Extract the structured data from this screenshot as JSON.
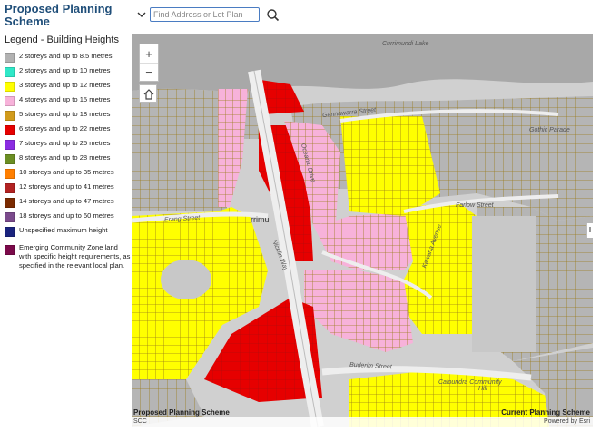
{
  "header": {
    "title": "Proposed Planning Scheme"
  },
  "search": {
    "placeholder": "Find Address or Lot Plan"
  },
  "legend": {
    "title": "Legend - Building Heights",
    "items": [
      {
        "label": "2 storeys and up to 8.5 metres",
        "color": "#b2b2b2"
      },
      {
        "label": "2 storeys and up to 10 metres",
        "color": "#2fe8c8"
      },
      {
        "label": "3 storeys and up to 12 metres",
        "color": "#ffff00"
      },
      {
        "label": "4 storeys and up to 15 metres",
        "color": "#f7b2da"
      },
      {
        "label": "5 storeys and up to 18 metres",
        "color": "#d19b1c"
      },
      {
        "label": "6 storeys and up to 22 metres",
        "color": "#e60000"
      },
      {
        "label": "7 storeys and up to 25 metres",
        "color": "#8a2be2"
      },
      {
        "label": "8 storeys and up to 28 metres",
        "color": "#6b8e23"
      },
      {
        "label": "10 storeys and up to 35 metres",
        "color": "#ff7f00"
      },
      {
        "label": "12 storeys and up to 41 metres",
        "color": "#b22222"
      },
      {
        "label": "14 storeys and up to 47 metres",
        "color": "#7a2a00"
      },
      {
        "label": "18 storeys and up to 60 metres",
        "color": "#7b4a8c"
      },
      {
        "label": "Unspecified maximum height",
        "color": "#1a237e"
      },
      {
        "label": "Emerging Community Zone land with specific height requirements, as specified in the relevant local plan.",
        "color": "#7b0a4a"
      }
    ]
  },
  "map": {
    "labels": {
      "lake": "Currimundi Lake",
      "gannawarra": "Gannawarra Street",
      "gothic": "Gothic Parade",
      "farlow": "Farlow Street",
      "erang": "Erang Street",
      "nicklin": "Nicklin Way",
      "buderim": "Buderim Street",
      "currimundi_fragment": "rrimu",
      "caloundra": "Caloundra Community",
      "oceanic": "Oceanic Drive",
      "kawana": "Kawana Avenue",
      "hill": "Hill"
    },
    "caption_left": "Proposed Planning Scheme",
    "caption_right": "Current Planning Scheme",
    "credit_left": "SCC",
    "credit_right": "Powered by Esri"
  }
}
